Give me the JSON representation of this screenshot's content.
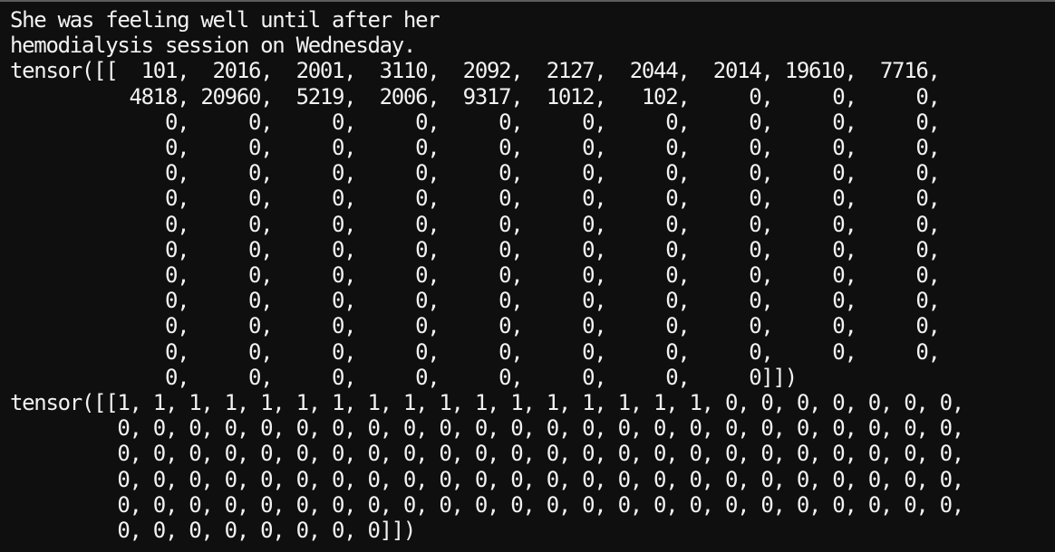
{
  "terminal": {
    "lines": [
      "She was feeling well until after her",
      "hemodialysis session on Wednesday.",
      "tensor([[  101,  2016,  2001,  3110,  2092,  2127,  2044,  2014, 19610,  7716,",
      "          4818, 20960,  5219,  2006,  9317,  1012,   102,     0,     0,     0,",
      "             0,     0,     0,     0,     0,     0,     0,     0,     0,     0,",
      "             0,     0,     0,     0,     0,     0,     0,     0,     0,     0,",
      "             0,     0,     0,     0,     0,     0,     0,     0,     0,     0,",
      "             0,     0,     0,     0,     0,     0,     0,     0,     0,     0,",
      "             0,     0,     0,     0,     0,     0,     0,     0,     0,     0,",
      "             0,     0,     0,     0,     0,     0,     0,     0,     0,     0,",
      "             0,     0,     0,     0,     0,     0,     0,     0,     0,     0,",
      "             0,     0,     0,     0,     0,     0,     0,     0,     0,     0,",
      "             0,     0,     0,     0,     0,     0,     0,     0,     0,     0,",
      "             0,     0,     0,     0,     0,     0,     0,     0,     0,     0,",
      "             0,     0,     0,     0,     0,     0,     0,     0]])",
      "tensor([[1, 1, 1, 1, 1, 1, 1, 1, 1, 1, 1, 1, 1, 1, 1, 1, 1, 0, 0, 0, 0, 0, 0, 0,",
      "         0, 0, 0, 0, 0, 0, 0, 0, 0, 0, 0, 0, 0, 0, 0, 0, 0, 0, 0, 0, 0, 0, 0, 0,",
      "         0, 0, 0, 0, 0, 0, 0, 0, 0, 0, 0, 0, 0, 0, 0, 0, 0, 0, 0, 0, 0, 0, 0, 0,",
      "         0, 0, 0, 0, 0, 0, 0, 0, 0, 0, 0, 0, 0, 0, 0, 0, 0, 0, 0, 0, 0, 0, 0, 0,",
      "         0, 0, 0, 0, 0, 0, 0, 0, 0, 0, 0, 0, 0, 0, 0, 0, 0, 0, 0, 0, 0, 0, 0, 0,",
      "         0, 0, 0, 0, 0, 0, 0, 0]])"
    ]
  }
}
